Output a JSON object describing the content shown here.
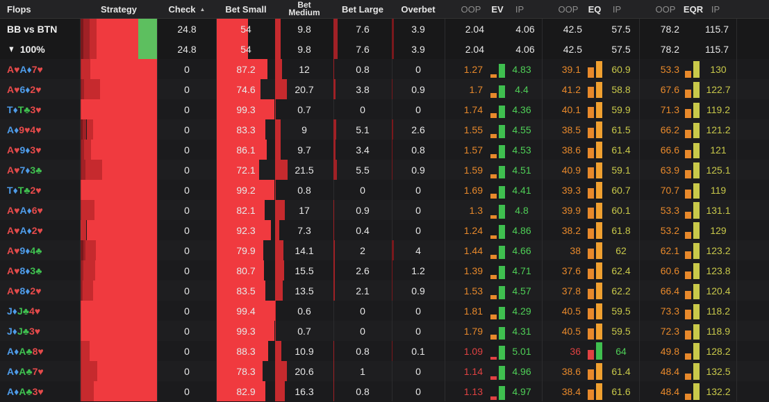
{
  "headers": {
    "flops": "Flops",
    "strategy": "Strategy",
    "check": "Check",
    "bet_small": "Bet Small",
    "bet_medium_1": "Bet",
    "bet_medium_2": "Medium",
    "bet_large": "Bet Large",
    "overbet": "Overbet",
    "oop1": "OOP",
    "ev": "EV",
    "ip1": "IP",
    "oop2": "OOP",
    "eq": "EQ",
    "ip2": "IP",
    "oop3": "OOP",
    "eqr": "EQR",
    "ip3": "IP"
  },
  "summary": [
    {
      "label": "BB vs BTN",
      "icon": "",
      "check": "24.8",
      "bet_small": "54",
      "bet_medium": "9.8",
      "bet_large": "7.6",
      "overbet": "3.9",
      "ev_oop": "2.04",
      "ev_ip": "4.06",
      "eq_oop": "42.5",
      "eq_ip": "57.5",
      "eqr_oop": "78.2",
      "eqr_ip": "115.7"
    },
    {
      "label": "100%",
      "icon": "filter-icon",
      "check": "24.8",
      "bet_small": "54",
      "bet_medium": "9.8",
      "bet_large": "7.6",
      "overbet": "3.9",
      "ev_oop": "2.04",
      "ev_ip": "4.06",
      "eq_oop": "42.5",
      "eq_ip": "57.5",
      "eqr_oop": "78.2",
      "eqr_ip": "115.7"
    }
  ],
  "colors": {
    "check": "#5dbf5f",
    "bet_small": "#f03a3f",
    "bet_medium": "#c62a2e",
    "bet_large": "#a02126",
    "overbet": "#7a181c",
    "oop_text": "#e8892b",
    "ip_text": "#c9c94a",
    "ev_low": "#e14242"
  },
  "rows": [
    {
      "cards": [
        [
          "A",
          "♥"
        ],
        [
          "A",
          "♦"
        ],
        [
          "7",
          "♥"
        ]
      ],
      "check": "0",
      "bet_small": "87.2",
      "bet_medium": "12",
      "bet_large": "0.8",
      "overbet": "0",
      "ev_oop": "1.27",
      "ev_ip": "4.83",
      "eq_oop": "39.1",
      "eq_ip": "60.9",
      "eqr_oop": "53.3",
      "eqr_ip": "130"
    },
    {
      "cards": [
        [
          "A",
          "♥"
        ],
        [
          "6",
          "♦"
        ],
        [
          "2",
          "♥"
        ]
      ],
      "check": "0",
      "bet_small": "74.6",
      "bet_medium": "20.7",
      "bet_large": "3.8",
      "overbet": "0.9",
      "ev_oop": "1.7",
      "ev_ip": "4.4",
      "eq_oop": "41.2",
      "eq_ip": "58.8",
      "eqr_oop": "67.6",
      "eqr_ip": "122.7"
    },
    {
      "cards": [
        [
          "T",
          "♦"
        ],
        [
          "T",
          "♣"
        ],
        [
          "3",
          "♥"
        ]
      ],
      "check": "0",
      "bet_small": "99.3",
      "bet_medium": "0.7",
      "bet_large": "0",
      "overbet": "0",
      "ev_oop": "1.74",
      "ev_ip": "4.36",
      "eq_oop": "40.1",
      "eq_ip": "59.9",
      "eqr_oop": "71.3",
      "eqr_ip": "119.2"
    },
    {
      "cards": [
        [
          "A",
          "♦"
        ],
        [
          "9",
          "♥"
        ],
        [
          "4",
          "♥"
        ]
      ],
      "check": "0",
      "bet_small": "83.3",
      "bet_medium": "9",
      "bet_large": "5.1",
      "overbet": "2.6",
      "ev_oop": "1.55",
      "ev_ip": "4.55",
      "eq_oop": "38.5",
      "eq_ip": "61.5",
      "eqr_oop": "66.2",
      "eqr_ip": "121.2"
    },
    {
      "cards": [
        [
          "A",
          "♥"
        ],
        [
          "9",
          "♦"
        ],
        [
          "3",
          "♥"
        ]
      ],
      "check": "0",
      "bet_small": "86.1",
      "bet_medium": "9.7",
      "bet_large": "3.4",
      "overbet": "0.8",
      "ev_oop": "1.57",
      "ev_ip": "4.53",
      "eq_oop": "38.6",
      "eq_ip": "61.4",
      "eqr_oop": "66.6",
      "eqr_ip": "121"
    },
    {
      "cards": [
        [
          "A",
          "♥"
        ],
        [
          "7",
          "♦"
        ],
        [
          "3",
          "♣"
        ]
      ],
      "check": "0",
      "bet_small": "72.1",
      "bet_medium": "21.5",
      "bet_large": "5.5",
      "overbet": "0.9",
      "ev_oop": "1.59",
      "ev_ip": "4.51",
      "eq_oop": "40.9",
      "eq_ip": "59.1",
      "eqr_oop": "63.9",
      "eqr_ip": "125.1"
    },
    {
      "cards": [
        [
          "T",
          "♦"
        ],
        [
          "T",
          "♣"
        ],
        [
          "2",
          "♥"
        ]
      ],
      "check": "0",
      "bet_small": "99.2",
      "bet_medium": "0.8",
      "bet_large": "0",
      "overbet": "0",
      "ev_oop": "1.69",
      "ev_ip": "4.41",
      "eq_oop": "39.3",
      "eq_ip": "60.7",
      "eqr_oop": "70.7",
      "eqr_ip": "119"
    },
    {
      "cards": [
        [
          "A",
          "♥"
        ],
        [
          "A",
          "♦"
        ],
        [
          "6",
          "♥"
        ]
      ],
      "check": "0",
      "bet_small": "82.1",
      "bet_medium": "17",
      "bet_large": "0.9",
      "overbet": "0",
      "ev_oop": "1.3",
      "ev_ip": "4.8",
      "eq_oop": "39.9",
      "eq_ip": "60.1",
      "eqr_oop": "53.3",
      "eqr_ip": "131.1"
    },
    {
      "cards": [
        [
          "A",
          "♥"
        ],
        [
          "A",
          "♦"
        ],
        [
          "2",
          "♥"
        ]
      ],
      "check": "0",
      "bet_small": "92.3",
      "bet_medium": "7.3",
      "bet_large": "0.4",
      "overbet": "0",
      "ev_oop": "1.24",
      "ev_ip": "4.86",
      "eq_oop": "38.2",
      "eq_ip": "61.8",
      "eqr_oop": "53.2",
      "eqr_ip": "129"
    },
    {
      "cards": [
        [
          "A",
          "♥"
        ],
        [
          "9",
          "♦"
        ],
        [
          "4",
          "♣"
        ]
      ],
      "check": "0",
      "bet_small": "79.9",
      "bet_medium": "14.1",
      "bet_large": "2",
      "overbet": "4",
      "ev_oop": "1.44",
      "ev_ip": "4.66",
      "eq_oop": "38",
      "eq_ip": "62",
      "eqr_oop": "62.1",
      "eqr_ip": "123.2"
    },
    {
      "cards": [
        [
          "A",
          "♥"
        ],
        [
          "8",
          "♦"
        ],
        [
          "3",
          "♣"
        ]
      ],
      "check": "0",
      "bet_small": "80.7",
      "bet_medium": "15.5",
      "bet_large": "2.6",
      "overbet": "1.2",
      "ev_oop": "1.39",
      "ev_ip": "4.71",
      "eq_oop": "37.6",
      "eq_ip": "62.4",
      "eqr_oop": "60.6",
      "eqr_ip": "123.8"
    },
    {
      "cards": [
        [
          "A",
          "♥"
        ],
        [
          "8",
          "♦"
        ],
        [
          "2",
          "♥"
        ]
      ],
      "check": "0",
      "bet_small": "83.5",
      "bet_medium": "13.5",
      "bet_large": "2.1",
      "overbet": "0.9",
      "ev_oop": "1.53",
      "ev_ip": "4.57",
      "eq_oop": "37.8",
      "eq_ip": "62.2",
      "eqr_oop": "66.4",
      "eqr_ip": "120.4"
    },
    {
      "cards": [
        [
          "J",
          "♦"
        ],
        [
          "J",
          "♣"
        ],
        [
          "4",
          "♥"
        ]
      ],
      "check": "0",
      "bet_small": "99.4",
      "bet_medium": "0.6",
      "bet_large": "0",
      "overbet": "0",
      "ev_oop": "1.81",
      "ev_ip": "4.29",
      "eq_oop": "40.5",
      "eq_ip": "59.5",
      "eqr_oop": "73.3",
      "eqr_ip": "118.2"
    },
    {
      "cards": [
        [
          "J",
          "♦"
        ],
        [
          "J",
          "♣"
        ],
        [
          "3",
          "♥"
        ]
      ],
      "check": "0",
      "bet_small": "99.3",
      "bet_medium": "0.7",
      "bet_large": "0",
      "overbet": "0",
      "ev_oop": "1.79",
      "ev_ip": "4.31",
      "eq_oop": "40.5",
      "eq_ip": "59.5",
      "eqr_oop": "72.3",
      "eqr_ip": "118.9"
    },
    {
      "cards": [
        [
          "A",
          "♦"
        ],
        [
          "A",
          "♣"
        ],
        [
          "8",
          "♥"
        ]
      ],
      "check": "0",
      "bet_small": "88.3",
      "bet_medium": "10.9",
      "bet_large": "0.8",
      "overbet": "0.1",
      "ev_oop": "1.09",
      "ev_ip": "5.01",
      "eq_oop": "36",
      "eq_ip": "64",
      "eqr_oop": "49.8",
      "eqr_ip": "128.2"
    },
    {
      "cards": [
        [
          "A",
          "♦"
        ],
        [
          "A",
          "♣"
        ],
        [
          "7",
          "♥"
        ]
      ],
      "check": "0",
      "bet_small": "78.3",
      "bet_medium": "20.6",
      "bet_large": "1",
      "overbet": "0",
      "ev_oop": "1.14",
      "ev_ip": "4.96",
      "eq_oop": "38.6",
      "eq_ip": "61.4",
      "eqr_oop": "48.4",
      "eqr_ip": "132.5"
    },
    {
      "cards": [
        [
          "A",
          "♦"
        ],
        [
          "A",
          "♣"
        ],
        [
          "3",
          "♥"
        ]
      ],
      "check": "0",
      "bet_small": "82.9",
      "bet_medium": "16.3",
      "bet_large": "0.8",
      "overbet": "0",
      "ev_oop": "1.13",
      "ev_ip": "4.97",
      "eq_oop": "38.4",
      "eq_ip": "61.6",
      "eqr_oop": "48.4",
      "eqr_ip": "132.2"
    }
  ]
}
